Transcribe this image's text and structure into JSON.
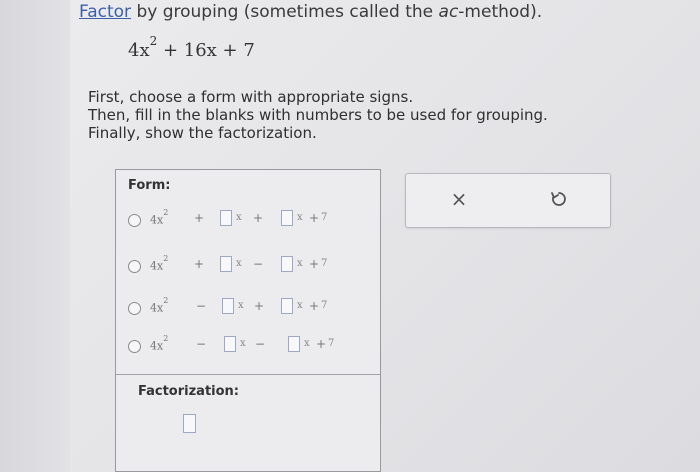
{
  "instructions": {
    "title_link": "Factor",
    "title_mid": " by grouping (sometimes called the ",
    "title_em": "ac",
    "title_end": "-method).",
    "expression": {
      "coef": "4x",
      "exp": "2",
      "rest": " + 16x + 7"
    },
    "steps": [
      "First, choose a form with appropriate signs.",
      "Then, fill in the blanks with numbers to be used for grouping.",
      "Finally, show the factorization."
    ]
  },
  "form": {
    "label": "Form:",
    "options": [
      {
        "lead": "4x",
        "exp": "2",
        "op1": "+",
        "op2": "+",
        "op3": "+",
        "var": "x",
        "const": "7"
      },
      {
        "lead": "4x",
        "exp": "2",
        "op1": "+",
        "op2": "−",
        "op3": "+",
        "var": "x",
        "const": "7"
      },
      {
        "lead": "4x",
        "exp": "2",
        "op1": "−",
        "op2": "+",
        "op3": "+",
        "var": "x",
        "const": "7"
      },
      {
        "lead": "4x",
        "exp": "2",
        "op1": "−",
        "op2": "−",
        "op3": "+",
        "var": "x",
        "const": "7"
      }
    ]
  },
  "factorization": {
    "label": "Factorization:"
  },
  "tools": {
    "clear_icon": "close-icon",
    "undo_icon": "undo-icon",
    "clear_glyph": "×"
  },
  "colors": {
    "link": "#3b5fa8",
    "input_border": "#9da7c6"
  }
}
